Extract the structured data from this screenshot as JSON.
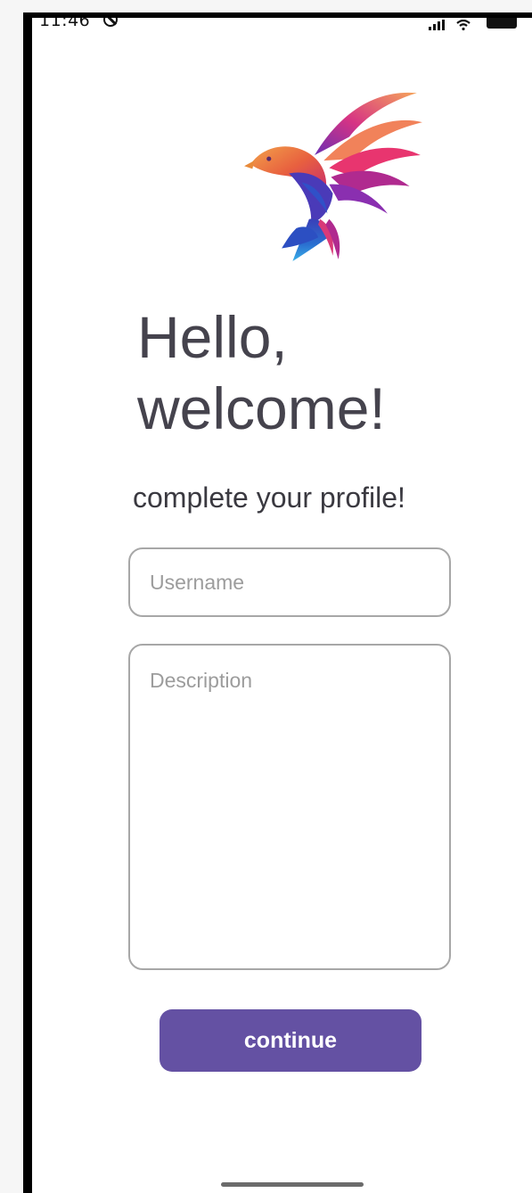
{
  "status_bar": {
    "time": "11:46",
    "icons": [
      "do-not-disturb-icon",
      "signal-icon",
      "wifi-icon",
      "battery-icon"
    ]
  },
  "logo": {
    "icon": "bird-logo-icon",
    "colors": [
      "#f2a24a",
      "#e8356f",
      "#b02a8f",
      "#6b2fb3",
      "#2c4fc2",
      "#3aa0e0"
    ]
  },
  "welcome": {
    "title_line1": "Hello,",
    "title_line2": "welcome!",
    "subtitle": "complete your profile!"
  },
  "form": {
    "username": {
      "value": "",
      "placeholder": "Username"
    },
    "description": {
      "value": "",
      "placeholder": "Description"
    }
  },
  "actions": {
    "continue_label": "continue"
  },
  "colors": {
    "accent": "#6451a3",
    "title_text": "#45434d",
    "field_border": "#a7a7a7",
    "placeholder": "#9c9c9c"
  }
}
